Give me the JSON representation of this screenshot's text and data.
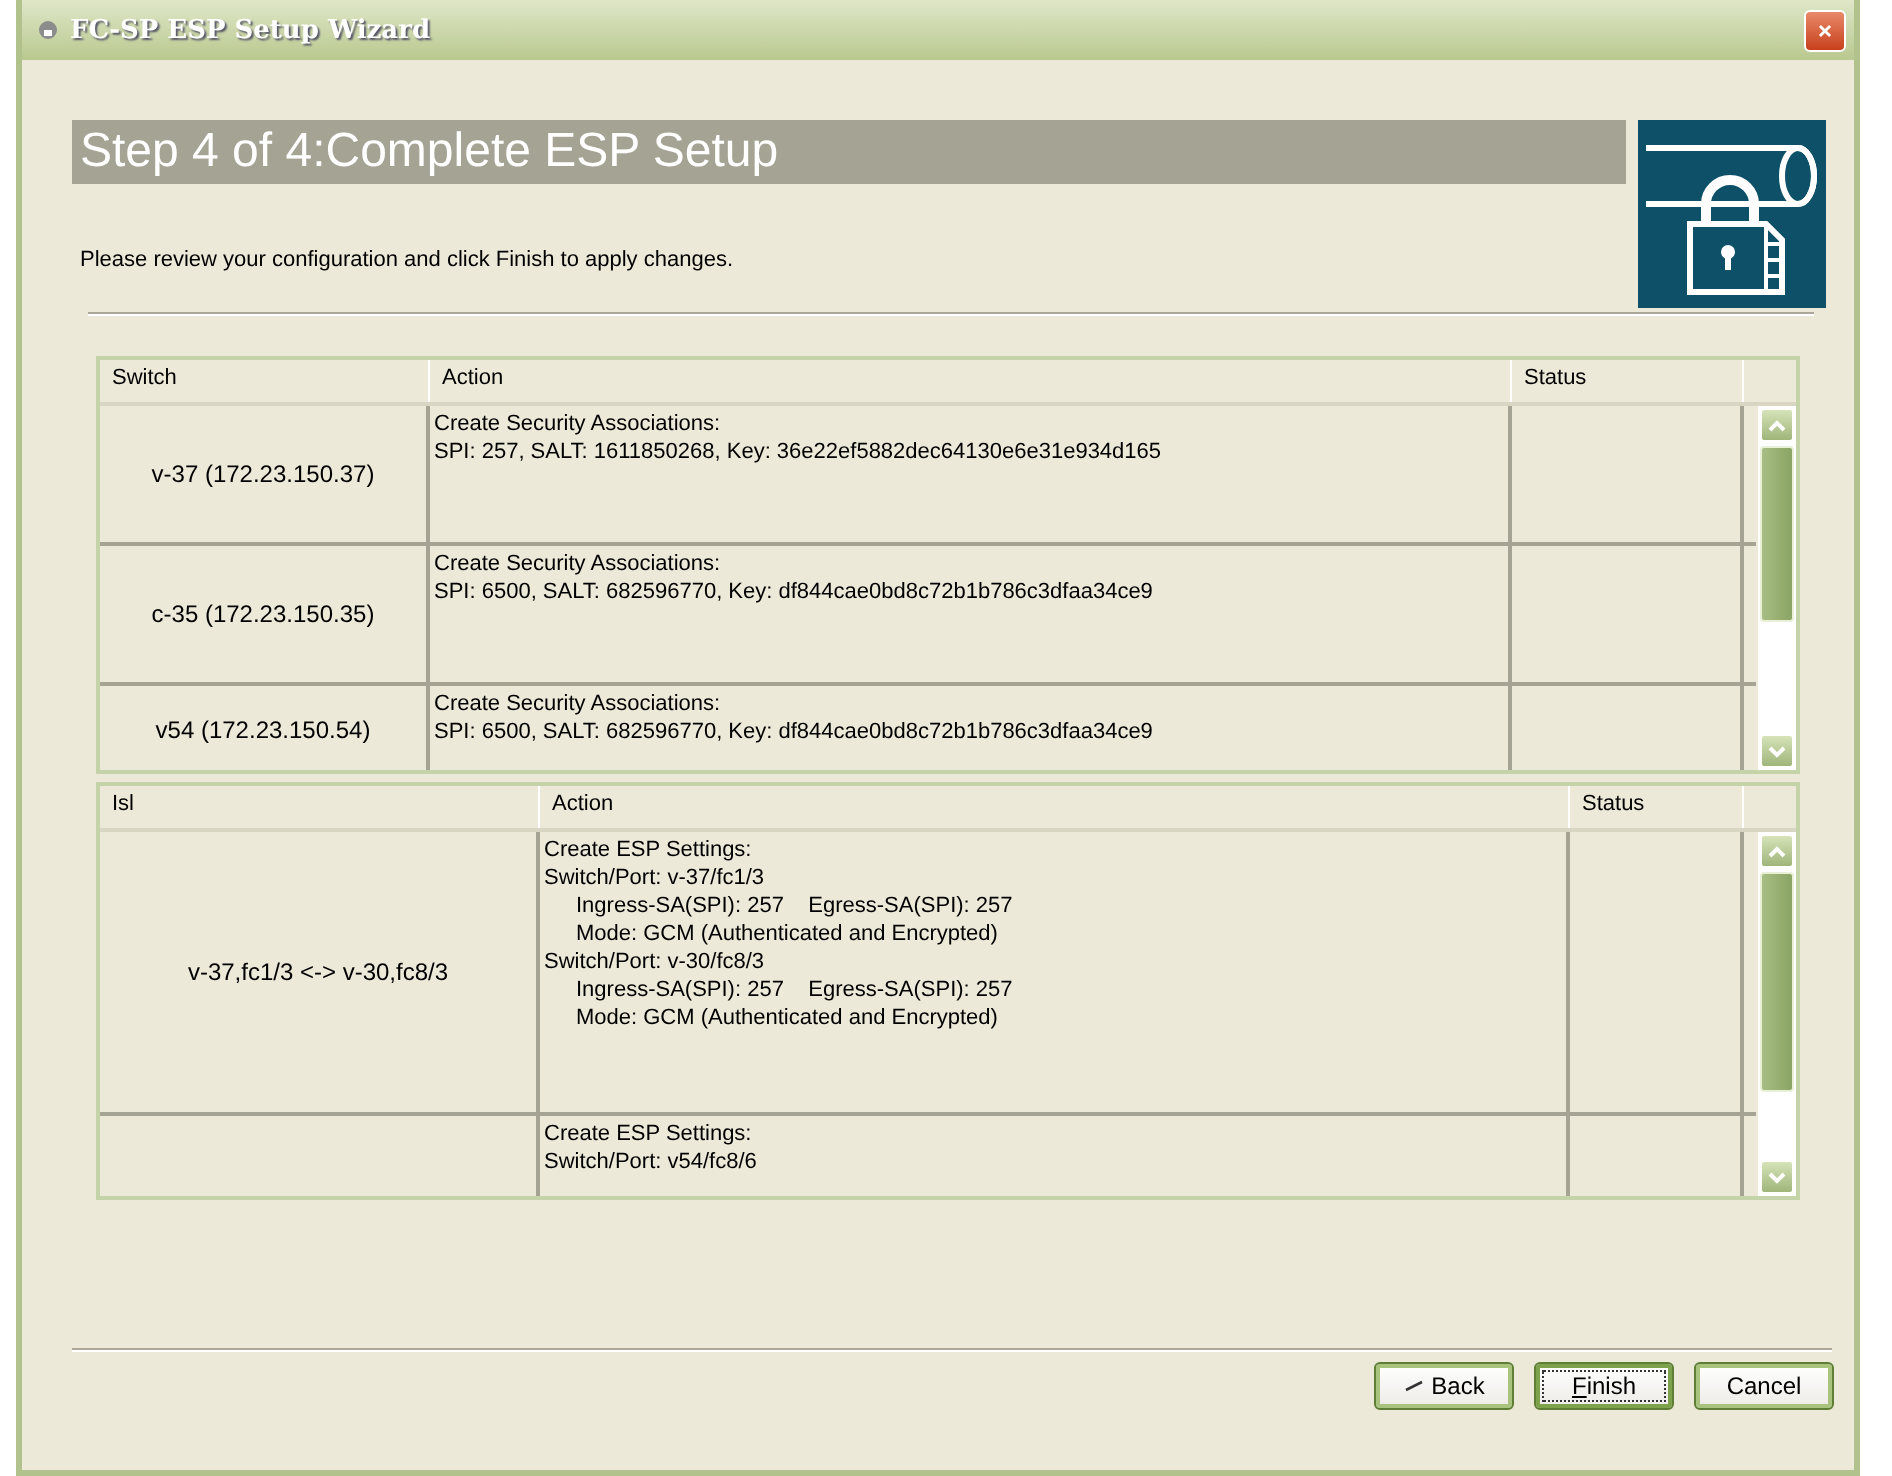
{
  "window": {
    "title": "FC-SP ESP Setup Wizard"
  },
  "step_title": "Step 4 of 4:Complete ESP Setup",
  "instructions": "Please review your configuration and click Finish to apply changes.",
  "switch_table": {
    "columns": [
      "Switch",
      "Action",
      "Status"
    ],
    "rows": [
      {
        "switch": "v-37 (172.23.150.37)",
        "action": [
          {
            "text": "Create Security Associations:",
            "indented": false
          },
          {
            "text": "SPI: 257, SALT: 1611850268, Key: 36e22ef5882dec64130e6e31e934d165",
            "indented": false
          }
        ]
      },
      {
        "switch": "c-35 (172.23.150.35)",
        "action": [
          {
            "text": "Create Security Associations:",
            "indented": false
          },
          {
            "text": "SPI: 6500, SALT: 682596770, Key: df844cae0bd8c72b1b786c3dfaa34ce9",
            "indented": false
          }
        ]
      },
      {
        "switch": "v54 (172.23.150.54)",
        "action": [
          {
            "text": "Create Security Associations:",
            "indented": false
          },
          {
            "text": "SPI: 6500, SALT: 682596770, Key: df844cae0bd8c72b1b786c3dfaa34ce9",
            "indented": false
          }
        ]
      }
    ]
  },
  "isl_table": {
    "columns": [
      "Isl",
      "Action",
      "Status"
    ],
    "rows": [
      {
        "isl": "v-37,fc1/3 <-> v-30,fc8/3",
        "action": [
          {
            "text": "Create ESP Settings:",
            "indented": false
          },
          {
            "text": "Switch/Port: v-37/fc1/3",
            "indented": false
          },
          {
            "text": "Ingress-SA(SPI): 257    Egress-SA(SPI): 257",
            "indented": true
          },
          {
            "text": "Mode: GCM (Authenticated and Encrypted)",
            "indented": true
          },
          {
            "text": "Switch/Port: v-30/fc8/3",
            "indented": false
          },
          {
            "text": "Ingress-SA(SPI): 257    Egress-SA(SPI): 257",
            "indented": true
          },
          {
            "text": "Mode: GCM (Authenticated and Encrypted)",
            "indented": true
          }
        ]
      },
      {
        "isl": "",
        "action": [
          {
            "text": "Create ESP Settings:",
            "indented": false
          },
          {
            "text": "Switch/Port: v54/fc8/6",
            "indented": false
          }
        ]
      }
    ]
  },
  "buttons": [
    {
      "label": "Back",
      "kind": "back"
    },
    {
      "label": "Finish",
      "kind": "default"
    },
    {
      "label": "Cancel",
      "kind": "plain"
    }
  ]
}
